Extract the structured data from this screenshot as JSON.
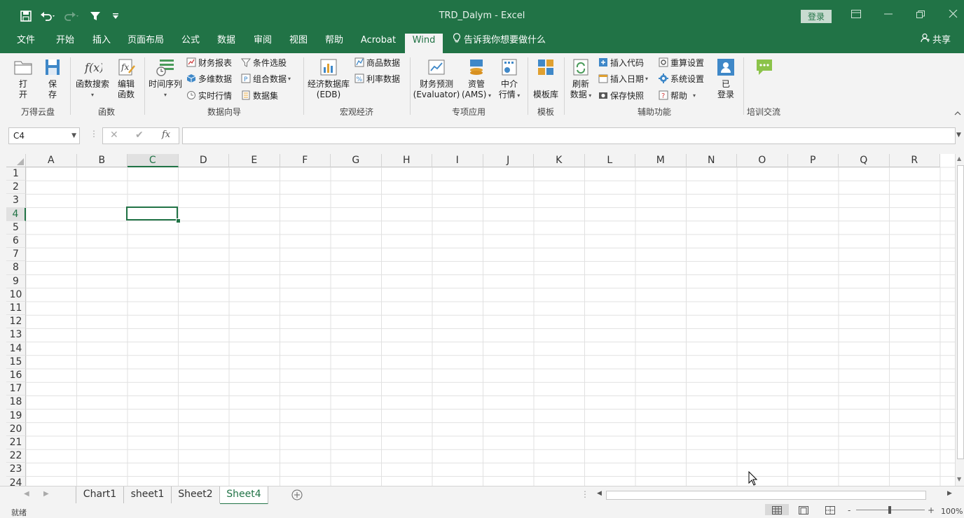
{
  "titlebar": {
    "title": "TRD_Dalym  -  Excel",
    "login_label": "登录",
    "accent": "#217346"
  },
  "menubar": {
    "tabs": [
      {
        "label": "文件"
      },
      {
        "label": "开始"
      },
      {
        "label": "插入"
      },
      {
        "label": "页面布局"
      },
      {
        "label": "公式"
      },
      {
        "label": "数据"
      },
      {
        "label": "审阅"
      },
      {
        "label": "视图"
      },
      {
        "label": "帮助"
      },
      {
        "label": "Acrobat"
      },
      {
        "label": "Wind",
        "active": true
      }
    ],
    "tell_me": "告诉我你想要做什么",
    "share": "共享"
  },
  "ribbon": {
    "groups": {
      "cloud": "万得云盘",
      "func": "函数",
      "guide": "数据向导",
      "macro": "宏观经济",
      "special": "专项应用",
      "template": "模板",
      "assist": "辅助功能",
      "training": "培训交流"
    },
    "buttons": {
      "open_1": "打",
      "open_2": "开",
      "save_1": "保",
      "save_2": "存",
      "func_search": "函数搜索",
      "edit_func_1": "编辑",
      "edit_func_2": "函数",
      "time_series": "时间序列",
      "finance_report": "财务报表",
      "multi_dim": "多维数据",
      "realtime": "实时行情",
      "condition_pick": "条件选股",
      "combo_data": "组合数据",
      "dataset": "数据集",
      "edb_1": "经济数据库",
      "edb_2": "(EDB)",
      "commodity": "商品数据",
      "interest": "利率数据",
      "evaluator_1": "财务预测",
      "evaluator_2": "(Evaluator)",
      "ams_1": "资管",
      "ams_2": "(AMS)",
      "broker_1": "中介",
      "broker_2": "行情",
      "template_lib": "模板库",
      "refresh_1": "刷新",
      "refresh_2": "数据",
      "insert_code": "插入代码",
      "insert_date": "插入日期",
      "save_snapshot": "保存快照",
      "recalc": "重算设置",
      "sys_settings": "系统设置",
      "help": "帮助",
      "logged_1": "已",
      "logged_2": "登录"
    }
  },
  "formula": {
    "namebox": "C4",
    "fx": "fx",
    "value": ""
  },
  "grid": {
    "columns": [
      "A",
      "B",
      "C",
      "D",
      "E",
      "F",
      "G",
      "H",
      "I",
      "J",
      "K",
      "L",
      "M",
      "N",
      "O",
      "P",
      "Q",
      "R"
    ],
    "rows": [
      "1",
      "2",
      "3",
      "4",
      "5",
      "6",
      "7",
      "8",
      "9",
      "10",
      "11",
      "12",
      "13",
      "14",
      "15",
      "16",
      "17",
      "18",
      "19",
      "20",
      "21",
      "22",
      "23",
      "24"
    ],
    "selected_col": "C",
    "selected_row": "4"
  },
  "sheets": {
    "tabs": [
      {
        "label": "Chart1"
      },
      {
        "label": "sheet1"
      },
      {
        "label": "Sheet2"
      },
      {
        "label": "Sheet4",
        "active": true
      }
    ]
  },
  "status": {
    "ready": "就绪",
    "zoom": "100%"
  }
}
